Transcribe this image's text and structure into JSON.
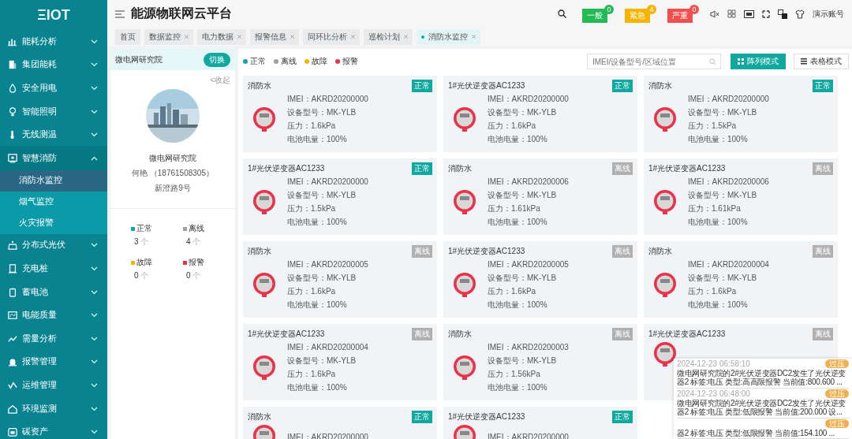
{
  "sidebar": {
    "logo": "ΞIOT",
    "items": [
      {
        "label": "能耗分析",
        "expanded": false
      },
      {
        "label": "集团能耗",
        "expanded": false
      },
      {
        "label": "安全用电",
        "expanded": false
      },
      {
        "label": "智能照明",
        "expanded": false
      },
      {
        "label": "无线测温",
        "expanded": false
      },
      {
        "label": "智慧消防",
        "expanded": true,
        "children": [
          {
            "label": "消防水监控",
            "selected": true
          },
          {
            "label": "烟气监控",
            "selected": false
          },
          {
            "label": "火灾报警",
            "selected": false
          }
        ]
      },
      {
        "label": "分布式光伏",
        "expanded": false
      },
      {
        "label": "充电桩",
        "expanded": false
      },
      {
        "label": "蓄电池",
        "expanded": false
      },
      {
        "label": "电能质量",
        "expanded": false
      },
      {
        "label": "需量分析",
        "expanded": false
      },
      {
        "label": "报警管理",
        "expanded": false
      },
      {
        "label": "运维管理",
        "expanded": false
      },
      {
        "label": "环境监测",
        "expanded": false
      },
      {
        "label": "碳资产",
        "expanded": false
      }
    ]
  },
  "header": {
    "title": "能源物联网云平台",
    "alarms": [
      {
        "label": "一般",
        "count": "0",
        "color": "#22bb55"
      },
      {
        "label": "紧急",
        "count": "4",
        "color": "#f5b400"
      },
      {
        "label": "严重",
        "count": "0",
        "color": "#f05050"
      }
    ],
    "account": "演示账号"
  },
  "tabs": [
    {
      "label": "首页",
      "selected": false,
      "closable": false
    },
    {
      "label": "数据监控",
      "selected": false,
      "closable": true
    },
    {
      "label": "电力数据",
      "selected": false,
      "closable": true
    },
    {
      "label": "报警信息",
      "selected": false,
      "closable": true
    },
    {
      "label": "同环比分析",
      "selected": false,
      "closable": true
    },
    {
      "label": "巡检计划",
      "selected": false,
      "closable": true
    },
    {
      "label": "消防水监控",
      "selected": true,
      "closable": true
    }
  ],
  "site_panel": {
    "site": "微电网研究院",
    "switch_button": "切换",
    "collapse": "<收起",
    "name": "微电网研究院",
    "contact": "何艳 （18761508305）",
    "address": "新澄路9号",
    "stats": [
      {
        "label": "正常",
        "count": "3",
        "unit": "个",
        "color": "#11a8a0"
      },
      {
        "label": "离线",
        "count": "4",
        "unit": "个",
        "color": "#a0a0a0"
      },
      {
        "label": "故障",
        "count": "0",
        "unit": "个",
        "color": "#f5b400"
      },
      {
        "label": "报警",
        "count": "0",
        "unit": "个",
        "color": "#e8334a"
      }
    ]
  },
  "legend": [
    {
      "label": "正常",
      "color": "#11a8a0"
    },
    {
      "label": "离线",
      "color": "#a0a0a0"
    },
    {
      "label": "故障",
      "color": "#f5b400"
    },
    {
      "label": "报警",
      "color": "#e8334a"
    }
  ],
  "search": {
    "placeholder": "IMEI/设备型号/区域位置"
  },
  "view_modes": [
    {
      "label": "阵列模式",
      "selected": true
    },
    {
      "label": "表格模式",
      "selected": false
    }
  ],
  "devices": [
    {
      "title": "消防水",
      "status": "正常",
      "kind": "normal",
      "fields": [
        "IMEI：AKRD20200000",
        "设备型号：MK-YLB",
        "压力：1.6kPa",
        "电池电量：100%"
      ]
    },
    {
      "title": "1#光伏逆变器AC1233",
      "status": "正常",
      "kind": "normal",
      "fields": [
        "IMEI：AKRD20200000",
        "设备型号：MK-YLB",
        "压力：1.6kPa",
        "电池电量：100%"
      ]
    },
    {
      "title": "消防水",
      "status": "正常",
      "kind": "normal",
      "fields": [
        "IMEI：AKRD20200000",
        "设备型号：MK-YLB",
        "压力：1.5kPa",
        "电池电量：100%"
      ]
    },
    {
      "title": "1#光伏逆变器AC1233",
      "status": "正常",
      "kind": "normal",
      "fields": [
        "IMEI：AKRD20200000",
        "设备型号：MK-YLB",
        "压力：1.5kPa",
        "电池电量：100%"
      ]
    },
    {
      "title": "消防水",
      "status": "离线",
      "kind": "offline",
      "fields": [
        "IMEI：AKRD20200006",
        "设备型号：MK-YLB",
        "压力：1.61kPa",
        "电池电量：100%"
      ]
    },
    {
      "title": "1#光伏逆变器AC1233",
      "status": "离线",
      "kind": "offline",
      "fields": [
        "IMEI：AKRD20200006",
        "设备型号：MK-YLB",
        "压力：1.61kPa",
        "电池电量：100%"
      ]
    },
    {
      "title": "消防水",
      "status": "离线",
      "kind": "offline",
      "fields": [
        "IMEI：AKRD20200005",
        "设备型号：MK-YLB",
        "压力：1.6kPa",
        "电池电量：100%"
      ]
    },
    {
      "title": "1#光伏逆变器AC1233",
      "status": "离线",
      "kind": "offline",
      "fields": [
        "IMEI：AKRD20200005",
        "设备型号：MK-YLB",
        "压力：1.6kPa",
        "电池电量：100%"
      ]
    },
    {
      "title": "消防水",
      "status": "离线",
      "kind": "offline",
      "fields": [
        "IMEI：AKRD20200004",
        "设备型号：MK-YLB",
        "压力：1.6kPa",
        "电池电量：100%"
      ]
    },
    {
      "title": "1#光伏逆变器AC1233",
      "status": "离线",
      "kind": "offline",
      "fields": [
        "IMEI：AKRD20200004",
        "设备型号：MK-YLB",
        "压力：1.6kPa",
        "电池电量：100%"
      ]
    },
    {
      "title": "消防水",
      "status": "离线",
      "kind": "offline",
      "fields": [
        "IMEI：AKRD20200003",
        "设备型号：MK-YLB",
        "压力：1.56kPa",
        "电池电量：100%"
      ]
    },
    {
      "title": "1#光伏逆变器AC1233",
      "status": "离线",
      "kind": "offline"
    },
    {
      "title": "消防水",
      "status": "正常",
      "kind": "normal",
      "fields": [
        "IMEI：AKRD20200000"
      ]
    },
    {
      "title": "1#光伏逆变器AC1233",
      "status": "正常",
      "kind": "normal",
      "fields": [
        "IMEI：AKRD20200000"
      ]
    }
  ],
  "notifications": [
    {
      "time": "2024-12-23 06:58:10",
      "tag": "过压",
      "message": "微电网研究院的2#光伏逆变器DC2发生了光伏逆变器2 标签:电压 类型:高高限报警 当前值:800.600 ..."
    },
    {
      "time": "2024-12-23 06:48:00",
      "tag": "过压",
      "message": "微电网研究院的2#光伏逆变器DC2发生了光伏逆变器2 标签:电压 类型:低限报警 当前值:200.000 设..."
    },
    {
      "tag": "过压",
      "message": "器2 标签:电压 类型:低限报警 当前值:154.100 ..."
    }
  ]
}
